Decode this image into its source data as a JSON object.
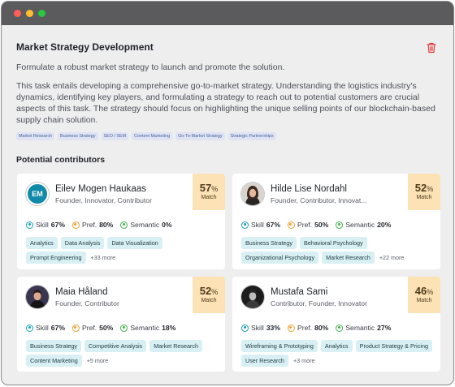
{
  "task": {
    "title": "Market Strategy Development",
    "subtitle": "Formulate a robust market strategy to launch and promote the solution.",
    "description": "This task entails developing a comprehensive go-to-market strategy. Understanding the logistics industry's dynamics, identifying key players, and formulating a strategy to reach out to potential customers are crucial aspects of this task. The strategy should focus on highlighting the unique selling points of our blockchain-based supply chain solution.",
    "tags": [
      "Market Research",
      "Business Strategy",
      "SEO / SEM",
      "Content Marketing",
      "Go-To-Market Strategy",
      "Strategic Partnerships"
    ]
  },
  "section_title": "Potential contributors",
  "labels": {
    "skill": "Skill",
    "pref": "Pref.",
    "semantic": "Semantic",
    "match": "Match",
    "pct_unit": "%"
  },
  "contributors": [
    {
      "initials": "EM",
      "name": "Eilev Mogen Haukaas",
      "role": "Founder, Innovator, Contributor",
      "match": "57",
      "skill": "67%",
      "pref": "80%",
      "semantic": "0%",
      "skills": [
        "Analytics",
        "Data Analysis",
        "Data Visualization",
        "Prompt Engineering"
      ],
      "more": "+33 more"
    },
    {
      "name": "Hilde Lise Nordahl",
      "role": "Founder, Contributor, Innovat...",
      "match": "52",
      "skill": "67%",
      "pref": "50%",
      "semantic": "20%",
      "skills": [
        "Business Strategy",
        "Behavioral Psychology",
        "Organizational Psychology",
        "Market Research"
      ],
      "more": "+22 more"
    },
    {
      "name": "Maia Håland",
      "role": "Founder, Contributor",
      "match": "52",
      "skill": "67%",
      "pref": "50%",
      "semantic": "18%",
      "skills": [
        "Business Strategy",
        "Competitive Analysis",
        "Market Research",
        "Content Marketing"
      ],
      "more": "+5 more"
    },
    {
      "name": "Mustafa Sami",
      "role": "Contributor, Founder, Innovator",
      "match": "46",
      "skill": "33%",
      "pref": "80%",
      "semantic": "27%",
      "skills": [
        "Wireframing & Prototyping",
        "Analytics",
        "Product Strategy & Pricing",
        "User Research"
      ],
      "more": "+3 more"
    }
  ],
  "colors": {
    "match_bg": "#fde2b5",
    "skill_icon": "#14a0b8",
    "pref_icon": "#f29d2a",
    "semantic_icon": "#3bb54a",
    "delete_icon": "#e03a3a",
    "initials_avatar": "#0f8aa8"
  },
  "icons": {
    "delete": "trash-icon",
    "skill": "skill-icon",
    "pref": "preference-icon",
    "semantic": "semantic-icon"
  }
}
